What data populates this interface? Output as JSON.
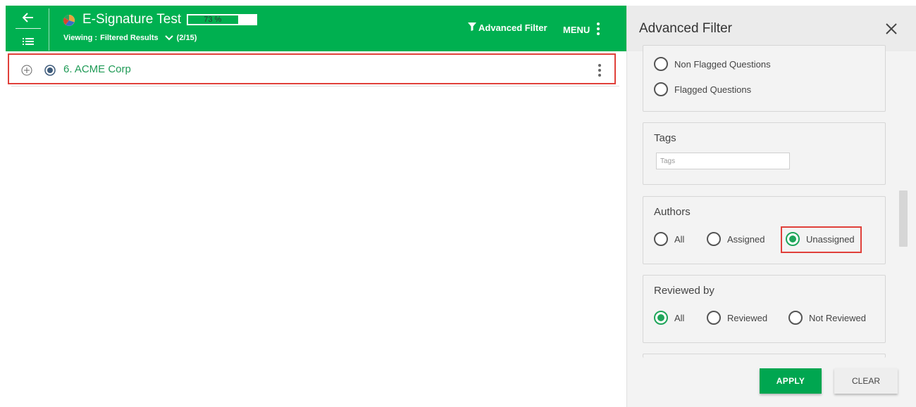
{
  "header": {
    "title": "E-Signature Test",
    "progress_label": "73 %",
    "progress_value": 0.73,
    "viewing_label": "Viewing :",
    "viewing_value": "Filtered Results",
    "viewing_count": "(2/15)",
    "advanced_filter_label": "Advanced Filter",
    "menu_label": "MENU",
    "icons": [
      "back-arrow-icon",
      "list-icon",
      "pie-chart-icon",
      "chevron-down-icon",
      "filter-icon",
      "kebab-icon"
    ]
  },
  "rows": [
    {
      "label": "6. ACME Corp"
    }
  ],
  "panel": {
    "title": "Advanced Filter",
    "flag_options": [
      {
        "label": "Non Flagged Questions",
        "selected": false
      },
      {
        "label": "Flagged Questions",
        "selected": false
      }
    ],
    "tags": {
      "title": "Tags",
      "placeholder": "Tags",
      "value": ""
    },
    "authors": {
      "title": "Authors",
      "options": [
        {
          "label": "All",
          "selected": false
        },
        {
          "label": "Assigned",
          "selected": false
        },
        {
          "label": "Unassigned",
          "selected": true
        }
      ]
    },
    "reviewed_by": {
      "title": "Reviewed by",
      "options": [
        {
          "label": "All",
          "selected": true
        },
        {
          "label": "Reviewed",
          "selected": false
        },
        {
          "label": "Not Reviewed",
          "selected": false
        }
      ]
    },
    "apply_label": "APPLY",
    "clear_label": "CLEAR"
  },
  "colors": {
    "header_green": "#00b050",
    "accent_green": "#1fa55a",
    "highlight_red": "#e0403a",
    "panel_bg": "#f3f3f3"
  }
}
